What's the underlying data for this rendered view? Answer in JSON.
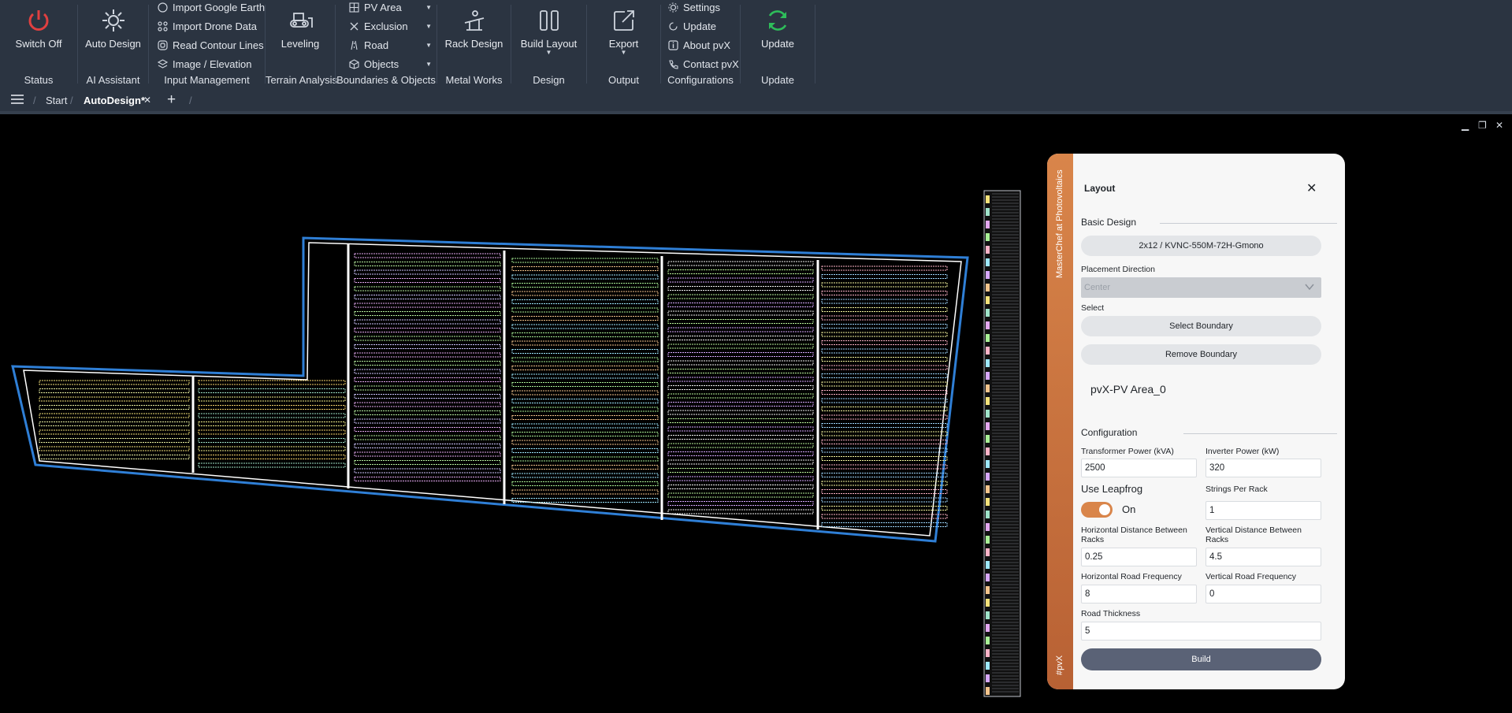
{
  "ribbon": {
    "status": {
      "button": "Switch Off",
      "group": "Status"
    },
    "ai": {
      "button": "Auto Design",
      "group": "AI Assistant"
    },
    "input": {
      "items": [
        "Import Google Earth",
        "Import Drone Data",
        "Read Contour Lines",
        "Image / Elevation"
      ],
      "group": "Input Management"
    },
    "terrain": {
      "button": "Leveling",
      "group": "Terrain Analysis"
    },
    "boundaries": {
      "items": [
        "PV Area",
        "Exclusion",
        "Road",
        "Objects"
      ],
      "group": "Boundaries & Objects"
    },
    "metal": {
      "button": "Rack Design",
      "group": "Metal Works"
    },
    "design": {
      "button": "Build Layout",
      "group": "Design"
    },
    "output": {
      "button": "Export",
      "group": "Output"
    },
    "config": {
      "items": [
        "Settings",
        "Update",
        "About pvX",
        "Contact pvX"
      ],
      "group": "Configurations"
    },
    "update": {
      "button": "Update",
      "group": "Update"
    }
  },
  "tabs": {
    "start": "Start",
    "active": "AutoDesign*"
  },
  "panel": {
    "side_text": "MasterChef at Photovoltaics",
    "side_tag": "#pvX",
    "title": "Layout",
    "basic_design": "Basic Design",
    "module": "2x12 / KVNC-550M-72H-Gmono",
    "placement_label": "Placement Direction",
    "placement_placeholder": "Center",
    "select_label": "Select",
    "select_boundary": "Select Boundary",
    "remove_boundary": "Remove Boundary",
    "selected_area": "pvX-PV Area_0",
    "configuration": "Configuration",
    "transformer_label": "Transformer Power (kVA)",
    "transformer_value": "2500",
    "inverter_label": "Inverter Power (kW)",
    "inverter_value": "320",
    "leapfrog_label": "Use Leapfrog",
    "leapfrog_state": "On",
    "strings_label": "Strings Per Rack",
    "strings_value": "1",
    "hdist_label": "Horizontal Distance Between Racks",
    "hdist_value": "0.25",
    "vdist_label": "Vertical Distance Between Racks",
    "vdist_value": "4.5",
    "hroad_label": "Horizontal Road Frequency",
    "hroad_value": "8",
    "vroad_label": "Vertical Road Frequency",
    "vroad_value": "0",
    "road_thick_label": "Road Thickness",
    "road_thick_value": "5",
    "build": "Build"
  },
  "colors": {
    "ribbon": "#2b3441",
    "accent": "#d9854a",
    "build": "#5a6276",
    "boundary": "#2f7fd6",
    "switch": "#e04040",
    "update": "#2ebd5a"
  }
}
